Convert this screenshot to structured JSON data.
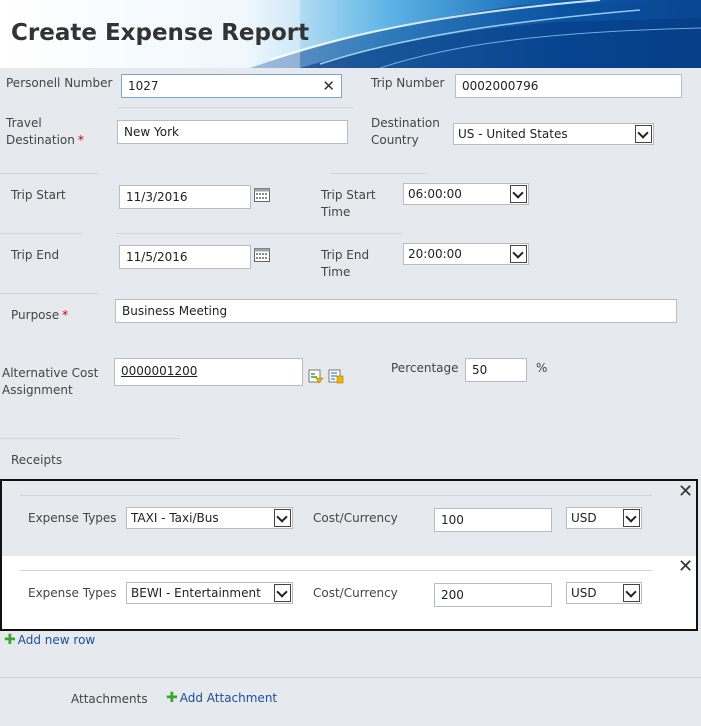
{
  "header": {
    "title": "Create Expense Report"
  },
  "fields": {
    "personnel_number": {
      "label": "Personell Number",
      "value": "1027",
      "clear_icon": "close-icon"
    },
    "trip_number": {
      "label": "Trip Number",
      "value": "0002000796"
    },
    "travel_destination": {
      "label_line1": "Travel",
      "label_line2": "Destination",
      "required": "*",
      "value": "New York"
    },
    "destination_country": {
      "label_line1": "Destination",
      "label_line2": "Country",
      "value": "US - United States"
    },
    "trip_start": {
      "label": "Trip Start",
      "value": "11/3/2016",
      "icon": "calendar-icon"
    },
    "trip_start_time": {
      "label_line1": "Trip Start",
      "label_line2": "Time",
      "value": "06:00:00"
    },
    "trip_end": {
      "label": "Trip End",
      "value": "11/5/2016",
      "icon": "calendar-icon"
    },
    "trip_end_time": {
      "label_line1": "Trip End",
      "label_line2": "Time",
      "value": "20:00:00"
    },
    "purpose": {
      "label": "Purpose",
      "required": "*",
      "value": "Business Meeting"
    },
    "alt_cost": {
      "label_line1": "Alternative Cost",
      "label_line2": "Assignment",
      "value": "0000001200"
    },
    "percentage": {
      "label": "Percentage",
      "value": "50",
      "unit": "%"
    }
  },
  "receipts": {
    "section_label": "Receipts",
    "rows": [
      {
        "expense_label": "Expense Types",
        "expense_value": "TAXI -  Taxi/Bus",
        "cost_label": "Cost/Currency",
        "amount": "100",
        "currency": "USD"
      },
      {
        "expense_label": "Expense Types",
        "expense_value": "BEWI -  Entertainment",
        "cost_label": "Cost/Currency",
        "amount": "200",
        "currency": "USD"
      }
    ],
    "add_row_label": "Add new row"
  },
  "attachments": {
    "label": "Attachments",
    "add_label": "Add Attachment"
  }
}
